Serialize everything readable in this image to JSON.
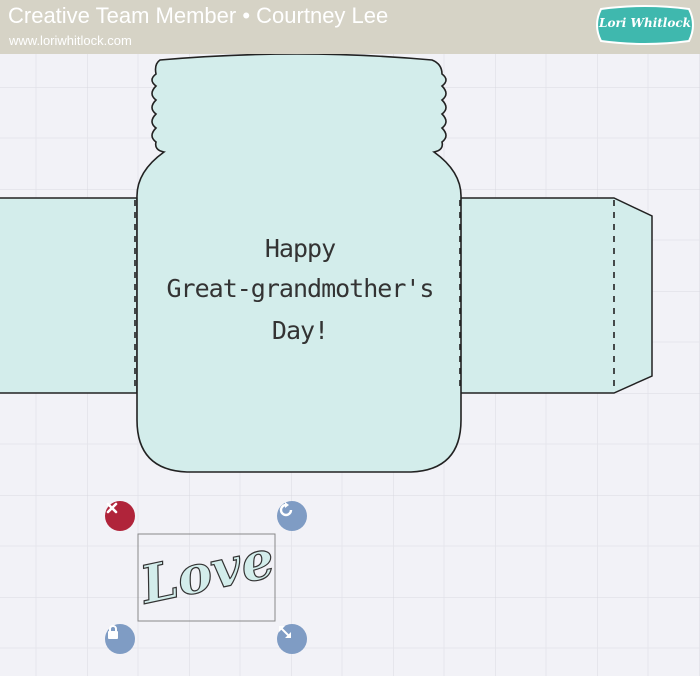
{
  "header": {
    "title": "Creative Team Member • Courtney Lee",
    "url": "www.loriwhitlock.com",
    "logo_text": "Lori Whitlock"
  },
  "card": {
    "line1": "Happy",
    "line2": "Great-grandmother's",
    "line3": "Day!"
  },
  "selection": {
    "word": "Love"
  },
  "controls": {
    "delete_icon": "x-icon",
    "rotate_icon": "rotate-icon",
    "lock_icon": "lock-icon",
    "scale_icon": "resize-icon"
  },
  "colors": {
    "header_bg": "#d6d3c6",
    "shape_fill": "#d3edeb",
    "delete": "#b0243a",
    "control": "#7f9cc4",
    "logo": "#3fb8ae"
  }
}
